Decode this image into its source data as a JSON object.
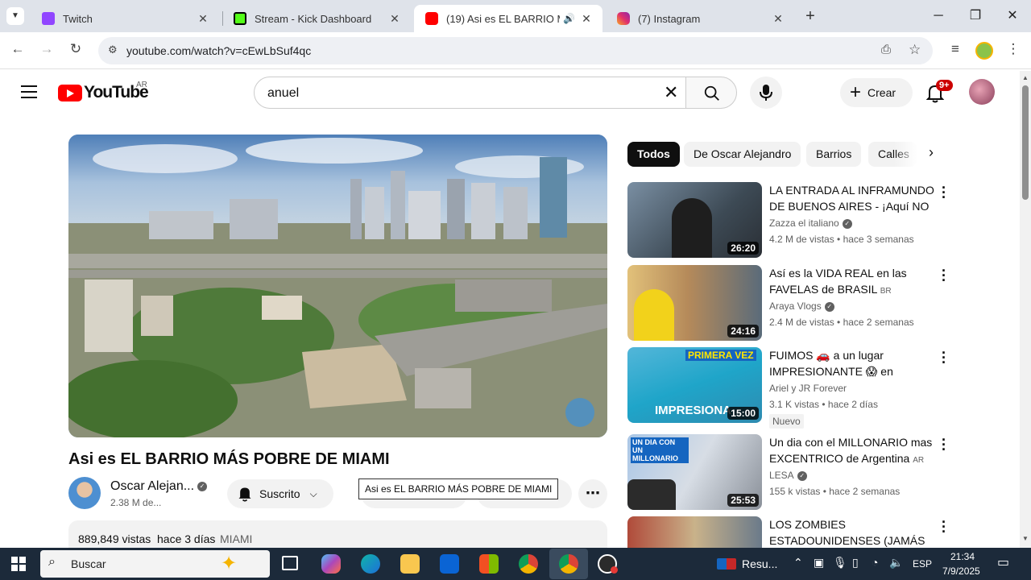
{
  "tabs": [
    {
      "title": "Twitch",
      "color": "#9146ff"
    },
    {
      "title": "Stream - Kick Dashboard",
      "color": "#53fc18"
    },
    {
      "title": "(19) Asi es EL BARRIO MÁS",
      "color": "#ff0000"
    },
    {
      "title": "(7) Instagram",
      "color": "#e1306c"
    }
  ],
  "address": {
    "url": "youtube.com/watch?v=cEwLbSuf4qc"
  },
  "youtube": {
    "logo_text": "YouTube",
    "region": "AR",
    "search_value": "anuel",
    "create_label": "Crear",
    "notif_count": "9+"
  },
  "video": {
    "title": "Asi es EL BARRIO MÁS POBRE DE MIAMI",
    "channel": "Oscar Alejan...",
    "subscribers": "2.38 M de...",
    "subscribe_label": "Suscrito",
    "share_label": "rtir",
    "tooltip": "Asi es EL BARRIO MÁS POBRE DE MIAMI",
    "views": "889,849 vistas",
    "date": "hace 3 días",
    "tag": "MIAMI"
  },
  "chips": [
    "Todos",
    "De Oscar Alejandro",
    "Barrios",
    "Calles"
  ],
  "related": [
    {
      "title": "LA ENTRADA AL INFRAMUNDO DE BUENOS AIRES - ¡Aquí NO ...",
      "channel": "Zazza el italiano",
      "verified": true,
      "meta": "4.2 M de vistas • hace 3 semanas",
      "duration": "26:20"
    },
    {
      "title": "Así es la VIDA REAL en las FAVELAS de BRASIL",
      "suffix": "BR",
      "channel": "Araya Vlogs",
      "verified": true,
      "meta": "2.4 M de vistas • hace 2 semanas",
      "duration": "24:16"
    },
    {
      "title": "FUIMOS 🚗 a un lugar IMPRESIONANTE 😱 en CUBA...",
      "channel": "Ariel y JR Forever",
      "verified": false,
      "meta": "3.1 K vistas • hace 2 días",
      "badge": "Nuevo",
      "duration": "15:00",
      "thumb_text_top": "PRIMERA VEZ",
      "thumb_text_bottom": "IMPRESIONA"
    },
    {
      "title": "Un dia con el MILLONARIO mas EXCENTRICO de Argentina",
      "suffix": "AR",
      "channel": "LESA",
      "verified": true,
      "meta": "155 k vistas • hace 2 semanas",
      "duration": "25:53",
      "thumb_text_top": "UN DIA CON UN MILLONARIO"
    },
    {
      "title": "LOS ZOMBIES ESTADOUNIDENSES (JAMÁS ...",
      "channel": "",
      "verified": false,
      "meta": "",
      "duration": ""
    }
  ],
  "taskbar": {
    "search_placeholder": "Buscar",
    "news_label": "Resu...",
    "lang": "ESP",
    "time": "21:34",
    "date": "7/9/2025"
  }
}
